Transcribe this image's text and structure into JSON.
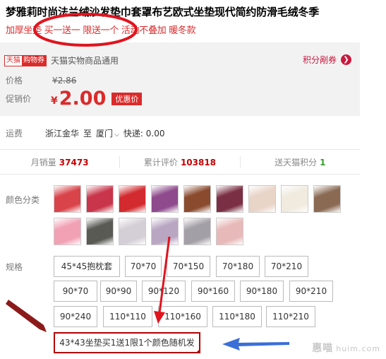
{
  "product": {
    "title": "梦雅莉时尚法兰绒沙发垫巾套罩布艺欧式坐垫现代简约防滑毛绒冬季",
    "subtitle": "加厚坐垫 买一送一 限送一个 活动不叠加 暖冬款"
  },
  "coupon": {
    "badge_left": "天猫",
    "badge_right": "购物券",
    "text": "天猫实物商品通用",
    "link_label": "积分剐券",
    "link_icon": "chevron-right-icon"
  },
  "price": {
    "label": "价格",
    "old": "¥2.86",
    "promo_label": "促销价",
    "currency": "¥",
    "value": "2.00",
    "tag": "优惠价"
  },
  "shipping": {
    "label": "运费",
    "from": "浙江金华",
    "to": "至",
    "city": "厦门",
    "fee": "快递: 0.00"
  },
  "stats": {
    "monthly_label": "月销量",
    "monthly_value": "37473",
    "reviews_label": "累计评价",
    "reviews_value": "103818",
    "points_label": "送天猫积分",
    "points_value": "1"
  },
  "colors": {
    "label": "颜色分类",
    "swatches": [
      {
        "name": "pink-red",
        "color": "#d9434a"
      },
      {
        "name": "rose-red",
        "color": "#c9354a"
      },
      {
        "name": "red",
        "color": "#d22a2e"
      },
      {
        "name": "purple",
        "color": "#8e4a8c"
      },
      {
        "name": "brown",
        "color": "#8a4a2d"
      },
      {
        "name": "wine",
        "color": "#7a2f44"
      },
      {
        "name": "beige",
        "color": "#e9d4c8"
      },
      {
        "name": "cream",
        "color": "#f0eadf"
      },
      {
        "name": "coffee",
        "color": "#8a6a53"
      },
      {
        "name": "pink",
        "color": "#f2a0b4"
      },
      {
        "name": "pattern",
        "color": "#5a5a55"
      },
      {
        "name": "grey-white",
        "color": "#d4cfd6"
      },
      {
        "name": "lavender",
        "color": "#b9a6c2"
      },
      {
        "name": "grey",
        "color": "#a39fa6"
      },
      {
        "name": "light-pink",
        "color": "#e7b9b8"
      }
    ]
  },
  "sizes": {
    "label": "规格",
    "options": [
      "45*45抱枕套",
      "70*70",
      "70*150",
      "70*180",
      "70*210",
      "90*70",
      "90*90",
      "90*120",
      "90*160",
      "90*180",
      "90*210",
      "90*240",
      "110*110",
      "110*160",
      "110*180",
      "110*210",
      "43*43坐垫买1送1限1个颜色随机发"
    ],
    "selected": "43*43坐垫买1送1限1个颜色随机发"
  },
  "watermark": {
    "text": "惠喵",
    "domain": "huim.com"
  },
  "annotation_colors": {
    "circle": "#e0141e",
    "red_arrow": "#e0141e",
    "dark_arrow": "#8b1a1a",
    "blue_arrow": "#3a6fd8"
  }
}
